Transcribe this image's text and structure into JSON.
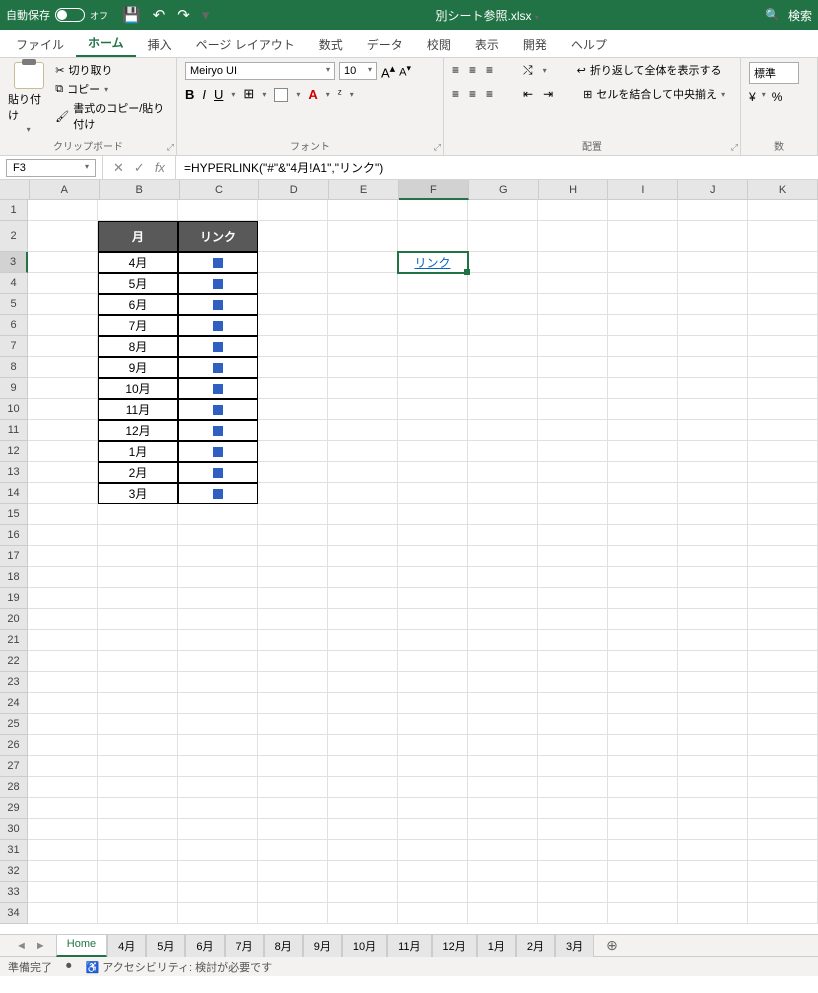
{
  "titlebar": {
    "autosave_label": "自動保存",
    "autosave_state": "オフ",
    "filename": "別シート参照.xlsx",
    "search_label": "検索"
  },
  "tabs": {
    "file": "ファイル",
    "home": "ホーム",
    "insert": "挿入",
    "pagelayout": "ページ レイアウト",
    "formulas": "数式",
    "data": "データ",
    "review": "校閲",
    "view": "表示",
    "developer": "開発",
    "help": "ヘルプ"
  },
  "ribbon": {
    "clipboard": {
      "paste": "貼り付け",
      "cut": "切り取り",
      "copy": "コピー",
      "formatpainter": "書式のコピー/貼り付け",
      "group_label": "クリップボード"
    },
    "font": {
      "name": "Meiryo UI",
      "size": "10",
      "group_label": "フォント"
    },
    "alignment": {
      "wrap": "折り返して全体を表示する",
      "merge": "セルを結合して中央揃え",
      "group_label": "配置"
    },
    "number": {
      "format": "標準",
      "group_label": "数"
    }
  },
  "formula_bar": {
    "cell_ref": "F3",
    "formula": "=HYPERLINK(\"#\"&\"4月!A1\",\"リンク\")"
  },
  "columns": [
    "A",
    "B",
    "C",
    "D",
    "E",
    "F",
    "G",
    "H",
    "I",
    "J",
    "K"
  ],
  "table": {
    "header_month": "月",
    "header_link": "リンク",
    "rows": [
      {
        "month": "4月"
      },
      {
        "month": "5月"
      },
      {
        "month": "6月"
      },
      {
        "month": "7月"
      },
      {
        "month": "8月"
      },
      {
        "month": "9月"
      },
      {
        "month": "10月"
      },
      {
        "month": "11月"
      },
      {
        "month": "12月"
      },
      {
        "month": "1月"
      },
      {
        "month": "2月"
      },
      {
        "month": "3月"
      }
    ]
  },
  "link_cell_text": "リンク",
  "row_count": 34,
  "sheet_tabs": [
    "Home",
    "4月",
    "5月",
    "6月",
    "7月",
    "8月",
    "9月",
    "10月",
    "11月",
    "12月",
    "1月",
    "2月",
    "3月"
  ],
  "statusbar": {
    "ready": "準備完了",
    "accessibility": "アクセシビリティ: 検討が必要です"
  }
}
